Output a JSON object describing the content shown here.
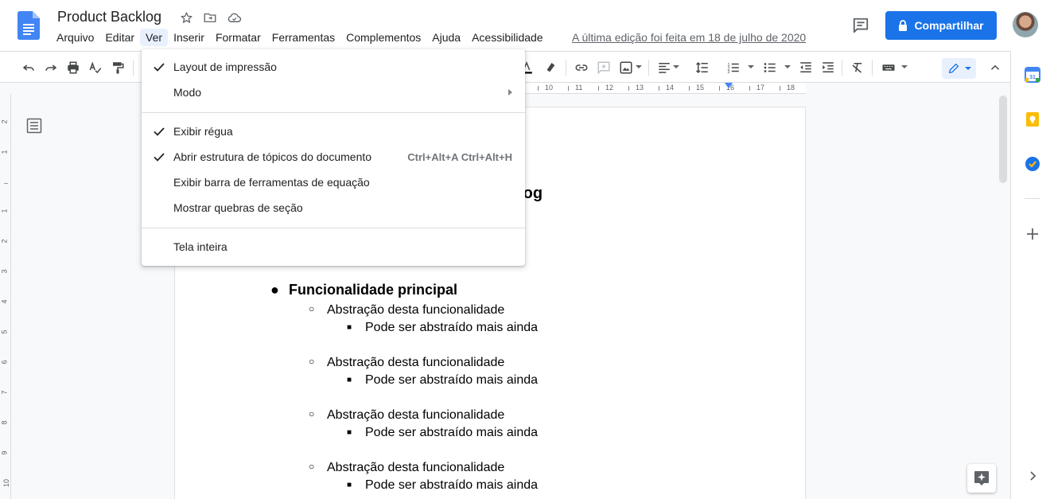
{
  "header": {
    "doc_title": "Product Backlog",
    "menu": [
      "Arquivo",
      "Editar",
      "Ver",
      "Inserir",
      "Formatar",
      "Ferramentas",
      "Complementos",
      "Ajuda",
      "Acessibilidade"
    ],
    "last_edit": "A última edição foi feita em 18 de julho de 2020",
    "share_label": "Compartilhar",
    "title_icons": [
      "star-icon",
      "move-to-folder-icon",
      "cloud-saved-icon"
    ]
  },
  "ruler": {
    "labels": [
      "10",
      "11",
      "12",
      "13",
      "14",
      "15",
      "16",
      "17",
      "18"
    ]
  },
  "vruler": {
    "labels": [
      "2",
      "1",
      "1",
      "2",
      "3",
      "4",
      "5",
      "6",
      "7",
      "8",
      "9",
      "10"
    ]
  },
  "view_menu": {
    "items": [
      {
        "label": "Layout de impressão",
        "checked": true
      },
      {
        "label": "Modo",
        "submenu": true
      },
      {
        "label": "Exibir régua",
        "checked": true
      },
      {
        "label": "Abrir estrutura de tópicos do documento",
        "checked": true,
        "shortcut": "Ctrl+Alt+A Ctrl+Alt+H"
      },
      {
        "label": "Exibir barra de ferramentas de equação"
      },
      {
        "label": "Mostrar quebras de seção"
      },
      {
        "label": "Tela inteira"
      }
    ]
  },
  "document": {
    "heading_fragment": "klog",
    "main_item": "Funcionalidade principal",
    "bullet_main": "●",
    "bullet_sub": "○",
    "bullet_sub2": "■",
    "groups": [
      {
        "sub": "Abstração desta funcionalidade",
        "detail": "Pode ser abstraído mais ainda"
      },
      {
        "sub": "Abstração desta funcionalidade",
        "detail": "Pode ser abstraído mais ainda"
      },
      {
        "sub": "Abstração desta funcionalidade",
        "detail": "Pode ser abstraído mais ainda"
      },
      {
        "sub": "Abstração desta funcionalidade",
        "detail": "Pode ser abstraído mais ainda"
      }
    ]
  },
  "colors": {
    "accent": "#1a73e8",
    "menu_active_bg": "#e8f0fe",
    "page_bg": "#f8f9fa"
  }
}
